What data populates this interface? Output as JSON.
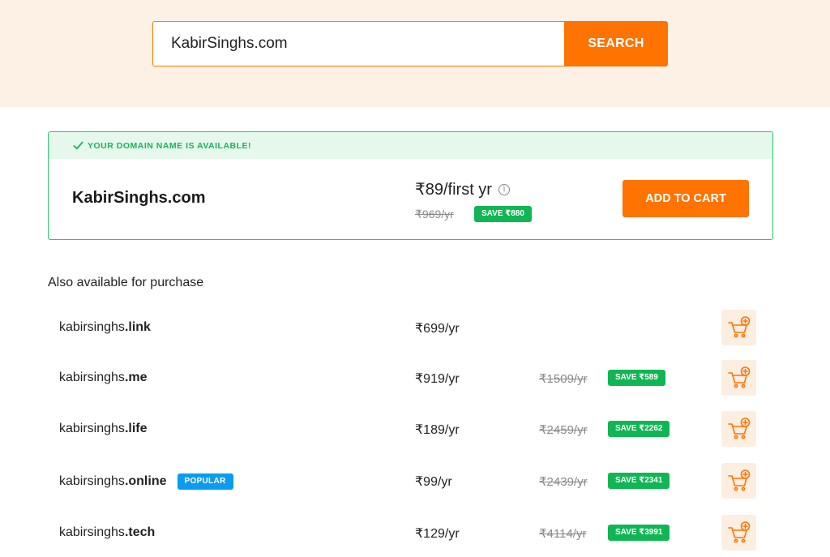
{
  "search": {
    "value": "KabirSinghs.com",
    "button_label": "SEARCH"
  },
  "availability": {
    "message": "YOUR DOMAIN NAME IS AVAILABLE!",
    "domain": "KabirSinghs.com",
    "price": "₹89/first yr",
    "original_price": "₹969/yr",
    "save_label": "SAVE ₹880",
    "add_to_cart_label": "ADD TO CART"
  },
  "also_available": {
    "title": "Also available for purchase",
    "items": [
      {
        "name": "kabirsinghs",
        "tld": ".link",
        "price": "₹699/yr",
        "original_price": "",
        "save_label": "",
        "badge": ""
      },
      {
        "name": "kabirsinghs",
        "tld": ".me",
        "price": "₹919/yr",
        "original_price": "₹1509/yr",
        "save_label": "SAVE ₹589",
        "badge": ""
      },
      {
        "name": "kabirsinghs",
        "tld": ".life",
        "price": "₹189/yr",
        "original_price": "₹2459/yr",
        "save_label": "SAVE ₹2262",
        "badge": ""
      },
      {
        "name": "kabirsinghs",
        "tld": ".online",
        "price": "₹99/yr",
        "original_price": "₹2439/yr",
        "save_label": "SAVE ₹2341",
        "badge": "POPULAR"
      },
      {
        "name": "kabirsinghs",
        "tld": ".tech",
        "price": "₹129/yr",
        "original_price": "₹4114/yr",
        "save_label": "SAVE ₹3991",
        "badge": ""
      }
    ]
  },
  "colors": {
    "accent": "#ff7300",
    "success": "#11b654",
    "popular": "#0a9cf0",
    "hero_bg": "#fdf0e4"
  },
  "icons": {
    "available": "check-icon",
    "info": "info-icon",
    "row_cart": "add-to-cart-icon"
  }
}
